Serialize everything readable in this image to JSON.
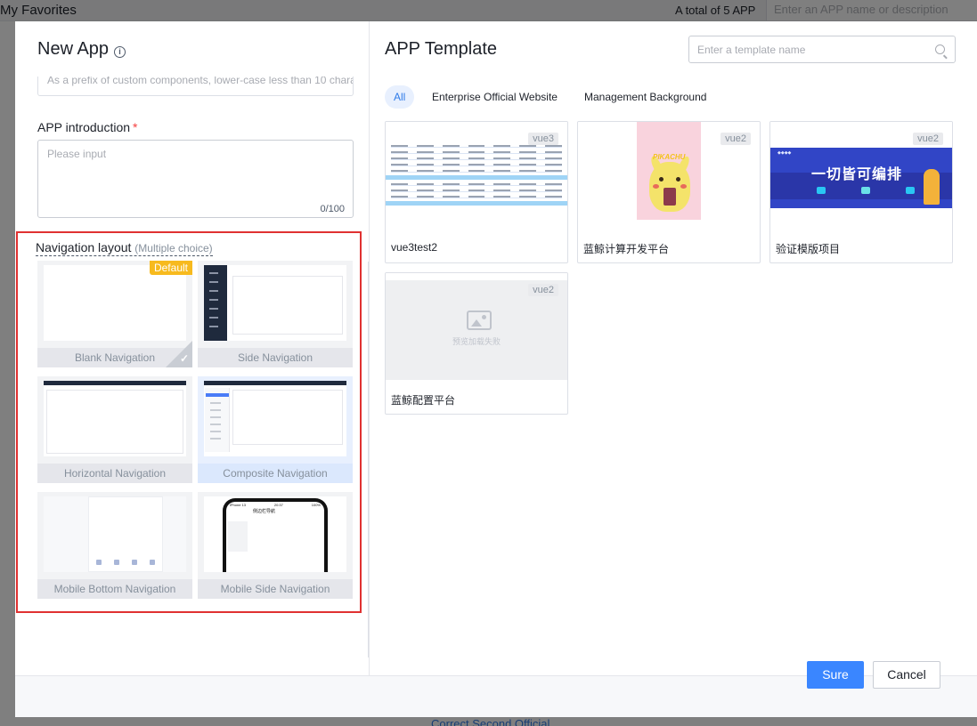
{
  "background": {
    "title": "My Favorites",
    "total": "A total of 5 APP",
    "search_placeholder": "Enter an APP name or description",
    "footer_link": "Correct Second Official"
  },
  "left": {
    "title": "New App",
    "prefix_placeholder": "As a prefix of custom components, lower-case less than 10 characters",
    "intro_label": "APP introduction",
    "intro_required": "*",
    "intro_placeholder": "Please input",
    "intro_count": "0/100",
    "nav_label": "Navigation layout",
    "nav_hint": "(Multiple choice)",
    "default_badge": "Default",
    "layouts": [
      {
        "label": "Blank Navigation"
      },
      {
        "label": "Side Navigation"
      },
      {
        "label": "Horizontal Navigation"
      },
      {
        "label": "Composite Navigation"
      },
      {
        "label": "Mobile Bottom Navigation"
      },
      {
        "label": "Mobile Side Navigation"
      }
    ],
    "phone_preview": {
      "carrier": "iPhone 13",
      "time": "20:37",
      "battery": "100%",
      "title": "侧边栏导航"
    }
  },
  "right": {
    "title": "APP Template",
    "search_placeholder": "Enter a template name",
    "tabs": [
      "All",
      "Enterprise Official Website",
      "Management Background"
    ],
    "templates": [
      {
        "name": "vue3test2",
        "tag": "vue3"
      },
      {
        "name": "蓝鲸计算开发平台",
        "tag": "vue2"
      },
      {
        "name": "验证模版项目",
        "tag": "vue2"
      },
      {
        "name": "蓝鲸配置平台",
        "tag": "vue2"
      }
    ],
    "banner_text": "一切皆可编排",
    "pika_text": "PIKACHU",
    "placeholder_text": "预览加载失败"
  },
  "footer": {
    "confirm": "Sure",
    "cancel": "Cancel"
  },
  "colors": {
    "primary": "#3a86ff",
    "highlight_border": "#e03131",
    "default_badge": "#f7ba1e"
  }
}
